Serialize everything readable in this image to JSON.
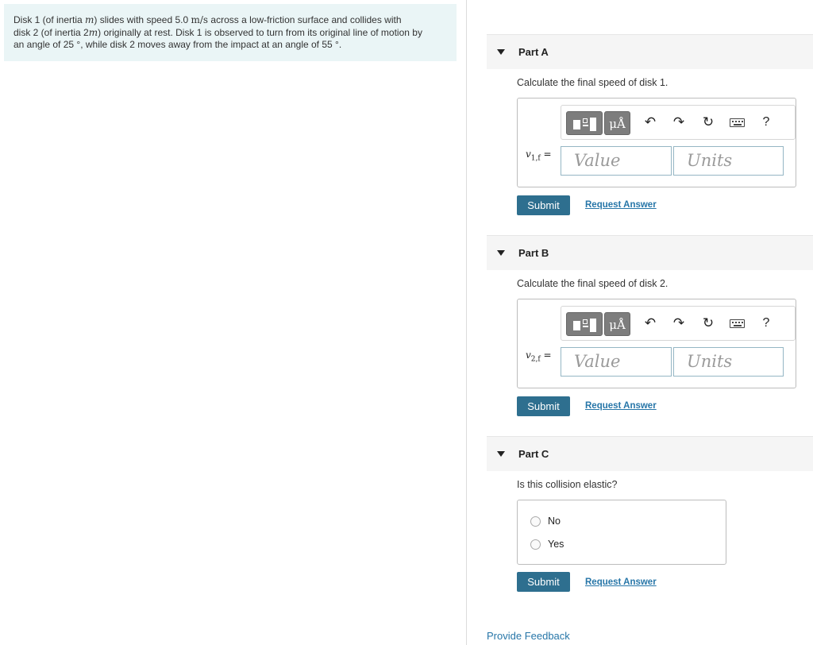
{
  "problem": {
    "line1_a": "Disk 1 (of inertia ",
    "line1_m": "m",
    "line1_b": ") slides with speed 5.0 ",
    "line1_unit": "m/s",
    "line1_c": " across a low-friction surface and collides with",
    "line2_a": "disk 2 (of inertia 2",
    "line2_m": "m",
    "line2_b": ") originally at rest. Disk 1 is observed to turn from its original line of motion by",
    "line3": "an angle of 25 °, while disk 2 moves away from the impact at an angle of 55 °."
  },
  "toolbar": {
    "units_label": "μÅ",
    "undo_icon": "undo-icon",
    "redo_icon": "redo-icon",
    "reset_icon": "reset-icon",
    "keyboard_icon": "keyboard-icon",
    "help_label": "?"
  },
  "parts": [
    {
      "title": "Part A",
      "question": "Calculate the final speed of disk 1.",
      "var_symbol": "v",
      "var_sub": "1,f",
      "var_eq": " =",
      "value_placeholder": "Value",
      "units_placeholder": "Units",
      "submit_label": "Submit",
      "request_label": "Request Answer"
    },
    {
      "title": "Part B",
      "question": "Calculate the final speed of disk 2.",
      "var_symbol": "v",
      "var_sub": "2,f",
      "var_eq": " =",
      "value_placeholder": "Value",
      "units_placeholder": "Units",
      "submit_label": "Submit",
      "request_label": "Request Answer"
    },
    {
      "title": "Part C",
      "question": "Is this collision elastic?",
      "options": [
        "No",
        "Yes"
      ],
      "submit_label": "Submit",
      "request_label": "Request Answer"
    }
  ],
  "footer": {
    "feedback_label": "Provide Feedback"
  },
  "colors": {
    "submit": "#2e6f8f",
    "link": "#2776a8",
    "problem_bg": "#eaf5f6"
  }
}
